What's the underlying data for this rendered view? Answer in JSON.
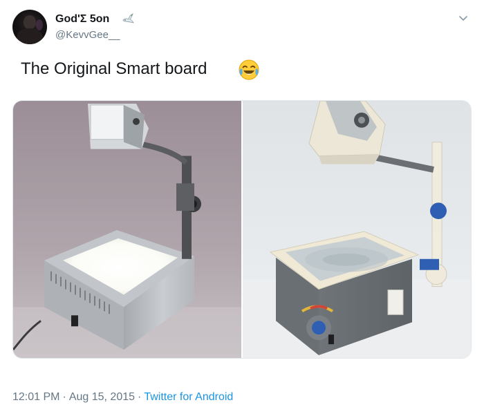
{
  "author": {
    "display_name": "God'Σ 5on",
    "handle": "@KevvGee__",
    "name_emoji": "dove-icon"
  },
  "tweet": {
    "text": "The Original Smart board",
    "emoji": "face-with-tears-of-joy-icon"
  },
  "media": {
    "count": 2,
    "images": [
      "overhead-projector-photo-white",
      "overhead-projector-photo-gray"
    ]
  },
  "footer": {
    "time": "12:01 PM",
    "date": "Aug 15, 2015",
    "separator": "·",
    "source": "Twitter for Android"
  },
  "colors": {
    "primary_text": "#14171a",
    "secondary_text": "#657786",
    "link": "#1b95e0",
    "border": "#e1e8ed"
  }
}
